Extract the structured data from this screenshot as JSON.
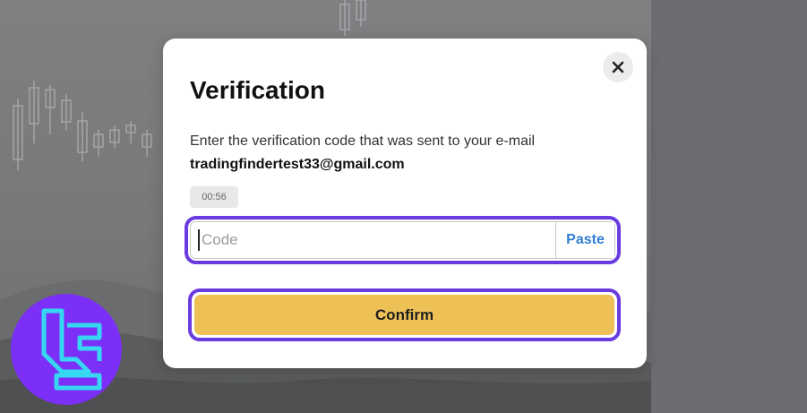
{
  "modal": {
    "title": "Verification",
    "description": "Enter the verification code that was sent to your e-mail",
    "email": "tradingfindertest33@gmail.com",
    "timer": "00:56",
    "code_placeholder": "Code",
    "code_value": "",
    "paste_label": "Paste",
    "confirm_label": "Confirm"
  },
  "icons": {
    "close": "close-icon",
    "logo": "brand-logo-icon"
  },
  "colors": {
    "accent_outline": "#6a3be0",
    "confirm_button": "#edc156",
    "paste_link": "#2f7fd1",
    "logo_circle": "#7b2ff7",
    "logo_mark": "#35d8f0"
  }
}
